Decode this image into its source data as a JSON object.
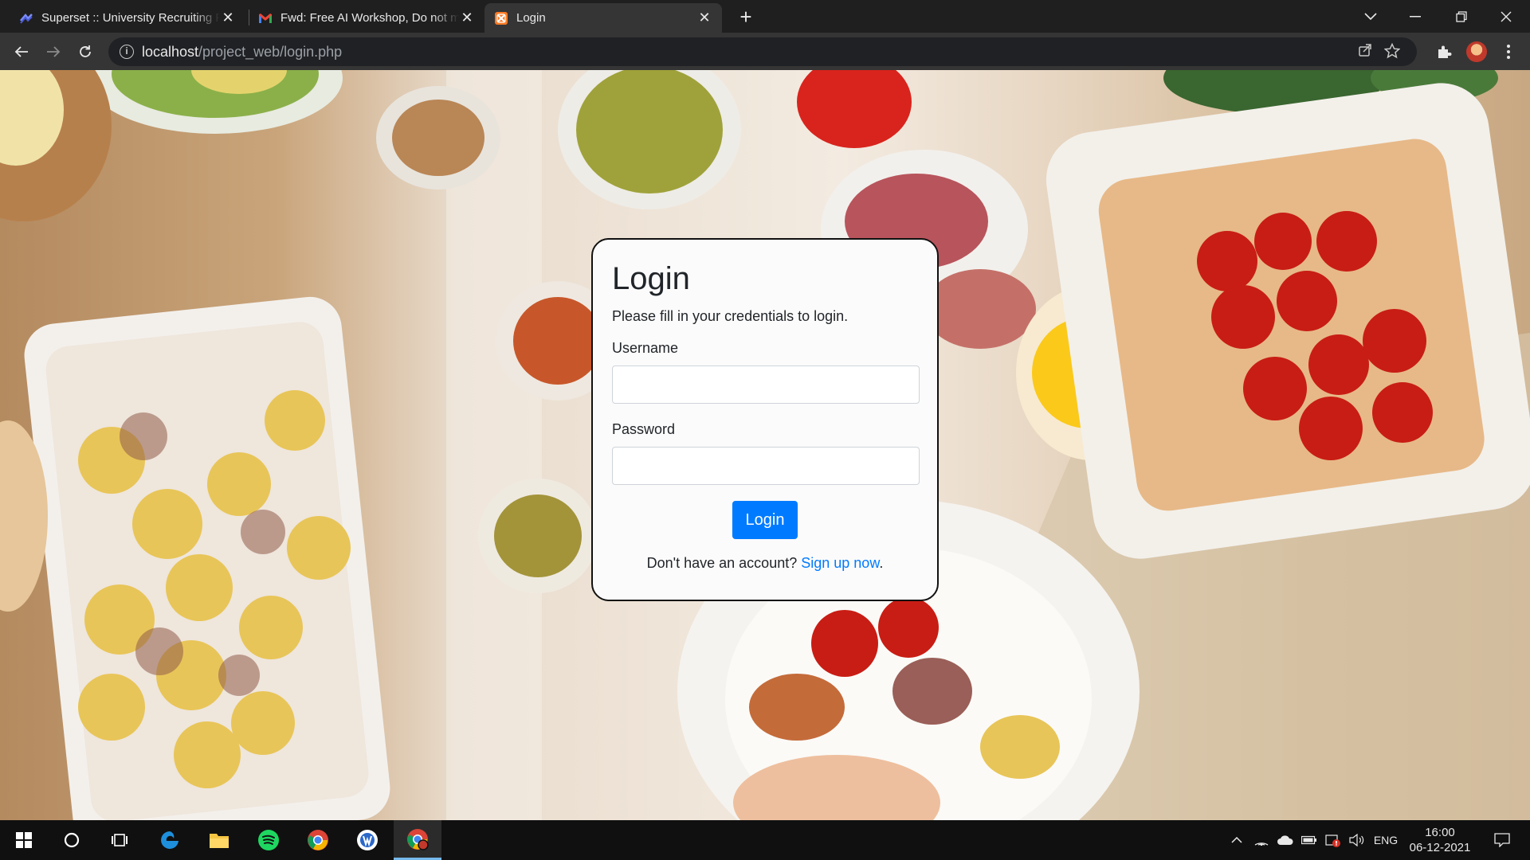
{
  "browser": {
    "tabs": [
      {
        "title": "Superset :: University Recruiting Pl",
        "icon": "superset-icon",
        "active": false
      },
      {
        "title": "Fwd: Free AI Workshop, Do not miss",
        "icon": "gmail-icon",
        "active": false
      },
      {
        "title": "Login",
        "icon": "xampp-icon",
        "active": true
      }
    ],
    "url_host": "localhost",
    "url_path": "/project_web/login.php"
  },
  "login": {
    "heading": "Login",
    "subtitle": "Please fill in your credentials to login.",
    "username_label": "Username",
    "username_value": "",
    "password_label": "Password",
    "password_value": "",
    "submit_label": "Login",
    "signup_prompt": "Don't have an account?",
    "signup_link": "Sign up now",
    "signup_period": "."
  },
  "taskbar": {
    "apps": [
      "windows-start",
      "search",
      "task-view",
      "edge",
      "file-explorer",
      "spotify",
      "chrome",
      "app",
      "chrome-active"
    ],
    "language": "ENG",
    "time": "16:00",
    "date": "06-12-2021"
  },
  "colors": {
    "accent": "#007bff",
    "chrome_dark": "#1f1f1f",
    "chrome_toolbar": "#353535"
  }
}
